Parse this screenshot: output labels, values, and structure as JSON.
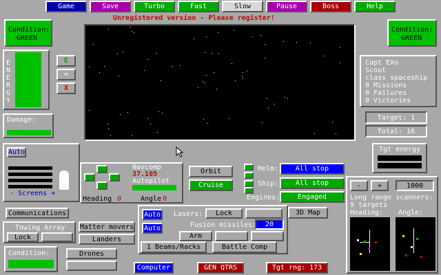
{
  "menu": {
    "game": "Game",
    "save": "Save",
    "turbo": "Turbo",
    "fast": "Fast",
    "slow": "Slow",
    "pause": "Pause",
    "boss": "Boss",
    "help": "Help"
  },
  "colors": {
    "game": "#0000a8",
    "save": "#a800a8",
    "turbo": "#00a800",
    "fast": "#00a800",
    "slow": "#a8a8a8",
    "pause": "#a800a8",
    "boss": "#a80000",
    "help": "#00a800"
  },
  "banner": "Unregistered version - Please register!",
  "condition_left": {
    "label": "Condition:",
    "value": "GREEN"
  },
  "condition_right": {
    "label": "Condition:",
    "value": "GREEN"
  },
  "energy": {
    "label": "ENERGY",
    "shield_btn": "E",
    "infinity_btn": "∞",
    "x_btn": "X"
  },
  "damage": {
    "label": "Damage:"
  },
  "captain": {
    "line1": "Capt EXo",
    "line2": "Scout",
    "line3": "class spaceship",
    "line4": "0 Missions",
    "line5": "0 Failures",
    "line6": "0 Victories"
  },
  "target": {
    "current": "Target: 1",
    "total": "Total: 16"
  },
  "tgt_energy": "Tgt energy",
  "screens": {
    "auto": "Auto",
    "label": "- Screens +",
    "scale": [
      "5",
      "4",
      "3",
      "2",
      "1"
    ]
  },
  "navcomp": {
    "label": "Navcomp",
    "value": "37.105",
    "autopilot": "Autopilot",
    "heading": "Heading",
    "heading_val": "0",
    "angle": "Angle",
    "angle_val": "0"
  },
  "orbit": "Orbit",
  "cruise": "Cruise",
  "helm": {
    "label": "Helm:",
    "value": "All stop"
  },
  "ship": {
    "label": "Ship:",
    "value": "All stop"
  },
  "engines": {
    "label": "Engines:",
    "value": "Engaged"
  },
  "scanner": {
    "minus": "-",
    "plus": "+",
    "range": "1000",
    "title": "Long range scanners:",
    "targets": "9 targets",
    "heading": "Heading:",
    "angle": "Angle:"
  },
  "communications": "Communications",
  "towing": {
    "label": "Towing Array",
    "lock": "Lock"
  },
  "matter": "Matter movers",
  "landers": "Landers",
  "condition_bottom": "Condition:",
  "drones": "Drones",
  "lasers": {
    "auto": "Auto",
    "label": "Lasers:",
    "lock": "Lock"
  },
  "fusion": {
    "auto": "Auto",
    "label": "Fusion missiles:",
    "value": "20",
    "arm": "Arm"
  },
  "beams": "1 Beams/Racks",
  "battle_comp": "Battle Comp",
  "map3d": "3D Map",
  "computer": "Computer",
  "gen_qtrs": "GEN QTRS",
  "tgt_rng": "Tgt rng: 173"
}
